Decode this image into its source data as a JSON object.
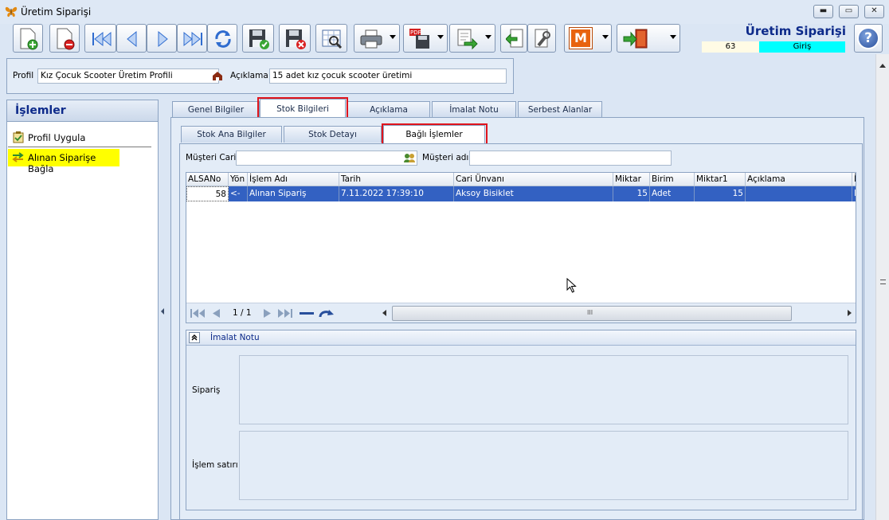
{
  "window": {
    "title": "Üretim Siparişi",
    "minimize": "▬",
    "maximize": "▭",
    "close": "✕"
  },
  "header": {
    "title": "Üretim Siparişi",
    "number": "63",
    "status": "Giriş",
    "help": "?"
  },
  "profile": {
    "label": "Profil",
    "value": "Kız Çocuk Scooter Üretim Profili",
    "desc_label": "Açıklama",
    "desc_value": "15 adet kız çocuk scooter üretimi"
  },
  "sidebar": {
    "title": "İşlemler",
    "items": [
      {
        "label": "Profil Uygula"
      },
      {
        "label": "Alınan Siparişe Bağla"
      }
    ]
  },
  "tabs": [
    "Genel Bilgiler",
    "Stok Bilgileri",
    "Açıklama",
    "İmalat Notu",
    "Serbest Alanlar"
  ],
  "subtabs": [
    "Stok Ana Bilgiler",
    "Stok Detayı",
    "Bağlı İşlemler"
  ],
  "customer": {
    "cari_label": "Müşteri Cari",
    "cari_value": "",
    "name_label": "Müşteri adı",
    "name_value": ""
  },
  "grid": {
    "columns": [
      "ALSANo",
      "Yön",
      "İşlem Adı",
      "Tarih",
      "Cari Ünvanı",
      "Miktar",
      "Birim",
      "Miktar1",
      "Açıklama",
      "İ"
    ],
    "rows": [
      [
        "58",
        "<-",
        "Alınan Sipariş",
        "7.11.2022 17:39:10",
        "Aksoy Bisiklet",
        "15",
        "Adet",
        "15",
        "",
        "I"
      ]
    ],
    "pager": "1 / 1",
    "scroll_grip": "III"
  },
  "notes": {
    "title": "İmalat Notu",
    "siparis_label": "Sipariş",
    "islem_label": "İşlem satırı",
    "siparis_value": "",
    "islem_value": ""
  },
  "toolbar_m": "M",
  "colors": {
    "accent_red": "#e0141c",
    "selection": "#3361c2",
    "status_cyan": "#00ffff",
    "title_blue": "#0d2a8a",
    "highlight": "#ffff00"
  }
}
